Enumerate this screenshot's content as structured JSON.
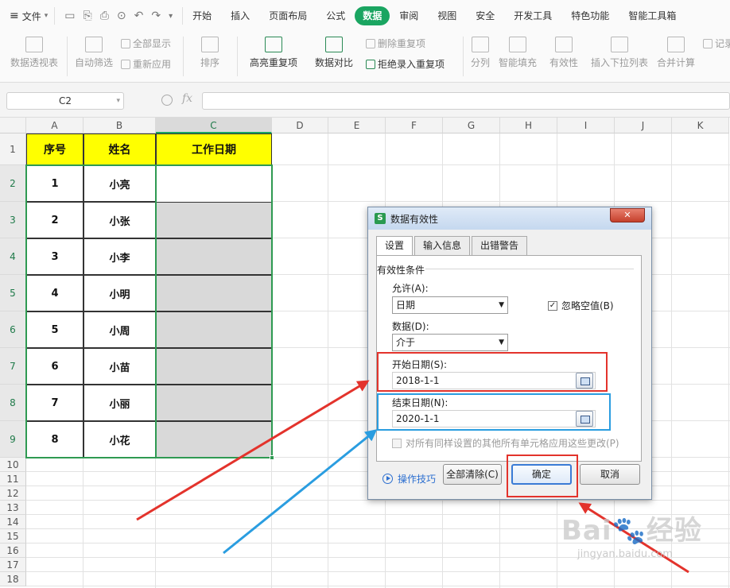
{
  "menubar": {
    "file_label": "文件",
    "tabs": [
      "开始",
      "插入",
      "页面布局",
      "公式",
      "数据",
      "审阅",
      "视图",
      "安全",
      "开发工具",
      "特色功能",
      "智能工具箱"
    ],
    "active_tab": "数据",
    "accent_color": "#1aa561"
  },
  "ribbon": {
    "pivot": "数据透视表",
    "autofilter": "自动筛选",
    "show_all": "全部显示",
    "reapply": "重新应用",
    "sort": "排序",
    "highlight_dup": "高亮重复项",
    "compare": "数据对比",
    "remove_dup": "删除重复项",
    "reject_dup": "拒绝录入重复项",
    "split": "分列",
    "smart_fill": "智能填充",
    "validity": "有效性",
    "insert_dropdown": "插入下拉列表",
    "consolidate": "合并计算",
    "record": "记录单"
  },
  "formula_bar": {
    "name_box": "C2",
    "fx": "fx",
    "content": ""
  },
  "sheet": {
    "columns": [
      "A",
      "B",
      "C",
      "D",
      "E",
      "F",
      "G",
      "H",
      "I",
      "J",
      "K"
    ],
    "selected_column": "C",
    "rows": [
      "1",
      "2",
      "3",
      "4",
      "5",
      "6",
      "7",
      "8",
      "9",
      "10",
      "11",
      "12",
      "13",
      "14",
      "15",
      "16",
      "17",
      "18"
    ],
    "headers": [
      "序号",
      "姓名",
      "工作日期"
    ],
    "data": [
      {
        "no": "1",
        "name": "小亮"
      },
      {
        "no": "2",
        "name": "小张"
      },
      {
        "no": "3",
        "name": "小李"
      },
      {
        "no": "4",
        "name": "小明"
      },
      {
        "no": "5",
        "name": "小周"
      },
      {
        "no": "6",
        "name": "小苗"
      },
      {
        "no": "7",
        "name": "小丽"
      },
      {
        "no": "8",
        "name": "小花"
      }
    ],
    "header_fill": "#ffff00",
    "selection_color": "#2f9a52"
  },
  "dialog": {
    "title": "数据有效性",
    "close": "✕",
    "tabs": [
      "设置",
      "输入信息",
      "出错警告"
    ],
    "group_title": "有效性条件",
    "allow_label": "允许(A):",
    "allow_value": "日期",
    "ignore_blank_label": "忽略空值(B)",
    "ignore_blank_checked": "✓",
    "data_label": "数据(D):",
    "data_value": "介于",
    "start_label": "开始日期(S):",
    "start_value": "2018-1-1",
    "end_label": "结束日期(N):",
    "end_value": "2020-1-1",
    "apply_all_label": "对所有同样设置的其他所有单元格应用这些更改(P)",
    "tips_label": "操作技巧",
    "clear_all": "全部清除(C)",
    "ok": "确定",
    "cancel": "取消"
  },
  "annotations": {
    "red": "#e3332c",
    "blue": "#2a9de0"
  },
  "watermark": {
    "logo": "Bai du 经验",
    "url": "jingyan.baidu.com"
  }
}
